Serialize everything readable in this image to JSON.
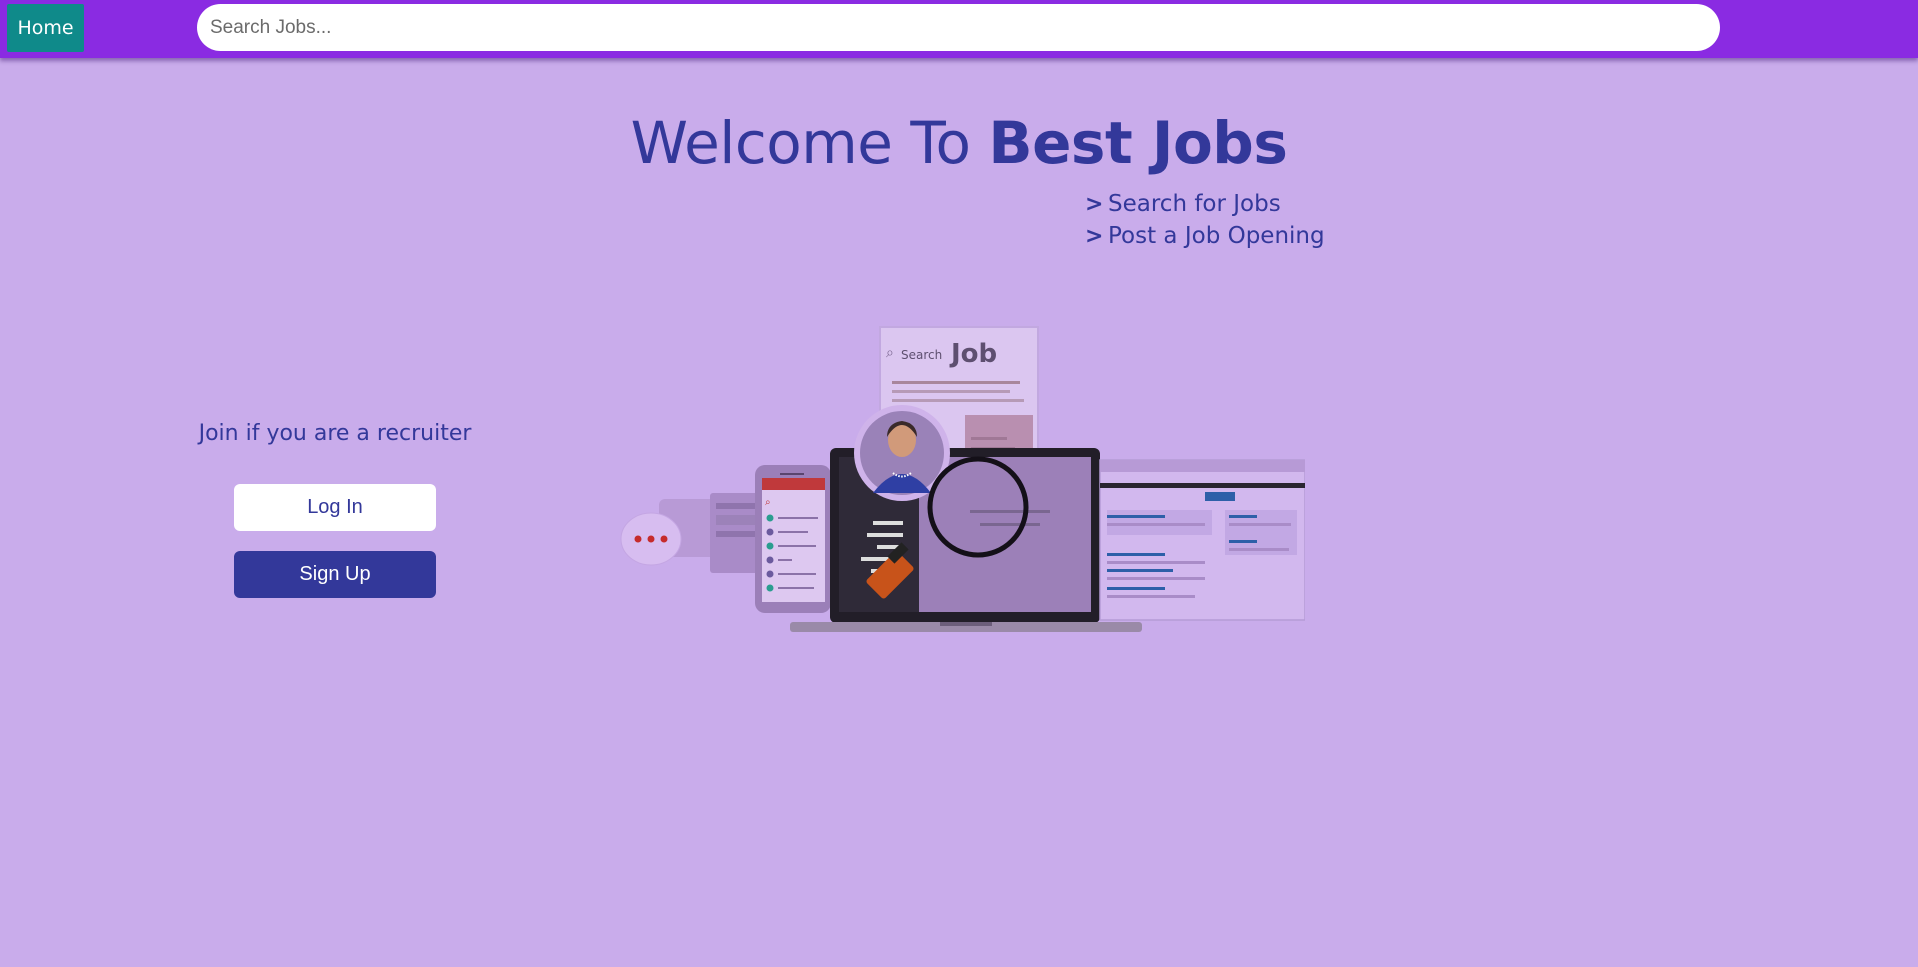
{
  "nav": {
    "home_label": "Home",
    "search_placeholder": "Search Jobs..."
  },
  "hero": {
    "title_prefix": "Welcome To ",
    "title_bold": "Best Jobs",
    "links": [
      {
        "arrow": ">",
        "label": "Search for Jobs"
      },
      {
        "arrow": ">",
        "label": "Post a Job Opening"
      }
    ]
  },
  "recruiter": {
    "prompt": "Join if you are a recruiter",
    "login_label": "Log In",
    "signup_label": "Sign Up"
  },
  "illustration": {
    "search_word": "Search",
    "job_word": "Job",
    "icons": [
      "search-icon",
      "person-avatar-icon",
      "magnifier-icon",
      "chat-bubble-icon",
      "phone-icon",
      "laptop-icon",
      "browser-window-icon"
    ]
  },
  "colors": {
    "navbar": "#8a2be2",
    "home_button": "#0f8a8a",
    "background": "#c9aceb",
    "accent": "#33389a"
  }
}
